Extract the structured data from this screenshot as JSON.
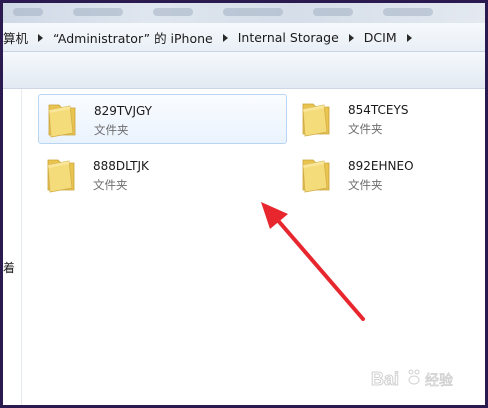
{
  "address_bar": {
    "crumbs": [
      "算机",
      "“Administrator” 的 iPhone",
      "Internal Storage",
      "DCIM"
    ]
  },
  "nav_pane": {
    "cropped_label": "着"
  },
  "folders": [
    {
      "name": "829TVJGY",
      "type": "文件夹",
      "selected": true
    },
    {
      "name": "854TCEYS",
      "type": "文件夹",
      "selected": false
    },
    {
      "name": "888DLTJK",
      "type": "文件夹",
      "selected": false
    },
    {
      "name": "892EHNEO",
      "type": "文件夹",
      "selected": false
    }
  ],
  "annotation": {
    "color": "#e8262d"
  },
  "watermark": {
    "brand": "Bai",
    "suffix": "经验"
  },
  "colors": {
    "folder_front": "#f5dc7a",
    "folder_back": "#e9c44e",
    "selection": "#b8d6f3"
  }
}
